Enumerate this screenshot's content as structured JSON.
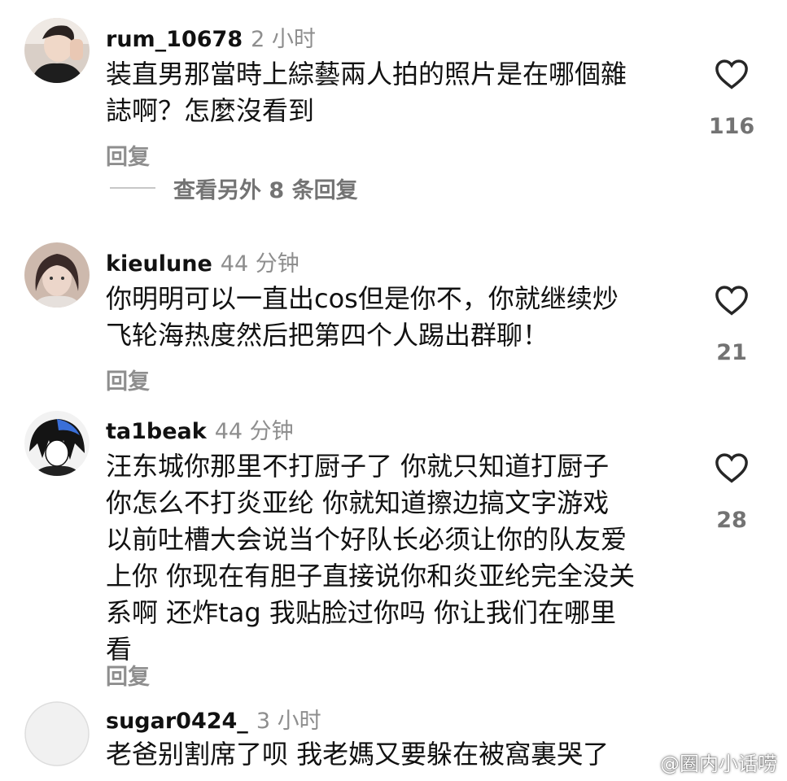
{
  "comments": [
    {
      "username": "rum_10678",
      "time": "2 小时",
      "text": "装直男那當時上綜藝兩人拍的照片是在哪個雜\n誌啊？怎麼沒看到",
      "likes": "116",
      "reply_label": "回复",
      "more_replies": "查看另外 8 条回复"
    },
    {
      "username": "kieulune",
      "time": "44 分钟",
      "text": "你明明可以一直出cos但是你不，你就继续炒\n飞轮海热度然后把第四个人踢出群聊！",
      "likes": "21",
      "reply_label": "回复"
    },
    {
      "username": "ta1beak",
      "time": "44 分钟",
      "text": "汪东城你那里不打厨子了 你就只知道打厨子\n你怎么不打炎亚纶 你就知道擦边搞文字游戏\n以前吐槽大会说当个好队长必须让你的队友爱\n上你 你现在有胆子直接说你和炎亚纶完全没关\n系啊 还炸tag 我贴脸过你吗 你让我们在哪里\n看",
      "likes": "28",
      "reply_label": "回复"
    },
    {
      "username": "sugar0424_",
      "time": "3 小时",
      "text": "老爸别割席了呗 我老媽又要躲在被窩裏哭了"
    }
  ],
  "watermark": "@圈内小话唠",
  "colors": {
    "secondary_text": "#8e8e8e",
    "like_outline": "#262626"
  }
}
